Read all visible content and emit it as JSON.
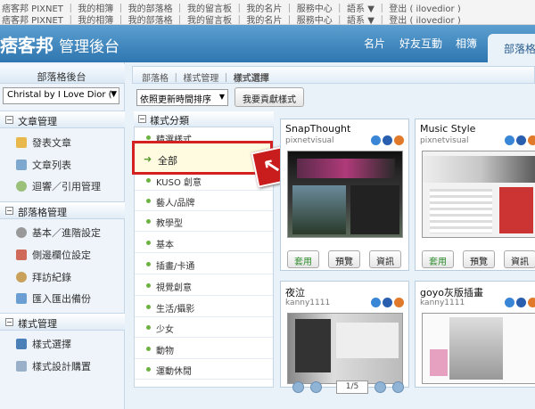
{
  "topbar": {
    "row1": "痞客邦 PIXNET ｜ 我的相簿 ｜ 我的部落格 ｜ 我的留言板 ｜ 我的名片 ｜ 服務中心 ｜ 語系 ▼ ｜ 登出 ( ilovedior )",
    "row2": "痞客邦 PIXNET ｜ 我的相簿 ｜ 我的部落格 ｜ 我的留言板 ｜ 我的名片 ｜ 服務中心 ｜ 語系 ▼ ｜ 登出 ( ilovedior )"
  },
  "header": {
    "logo": "痞客邦",
    "title": "管理後台",
    "nav": [
      "名片",
      "好友互動",
      "相簿"
    ],
    "active_tab": "部落格"
  },
  "sidebar": {
    "head": "部落格後台",
    "blog_select": "Christal by I Love Dior (",
    "sections": [
      {
        "title": "文章管理",
        "items": [
          "發表文章",
          "文章列表",
          "迴響／引用管理"
        ]
      },
      {
        "title": "部落格管理",
        "items": [
          "基本／進階設定",
          "側邊欄位設定",
          "拜訪紀錄",
          "匯入匯出備份"
        ]
      },
      {
        "title": "樣式管理",
        "items": [
          "樣式選擇",
          "樣式設計購置"
        ]
      }
    ]
  },
  "breadcrumb": [
    "部落格",
    "樣式管理",
    "樣式選擇"
  ],
  "sort": {
    "selected": "依照更新時間排序"
  },
  "contrib_button": "我要貢獻樣式",
  "categories": {
    "head": "樣式分類",
    "items": [
      "精選樣式",
      "全部",
      "KUSO 創意",
      "藝人/品牌",
      "教學型",
      "基本",
      "插畫/卡通",
      "視覺創意",
      "生活/攝影",
      "少女",
      "動物",
      "運動休閒"
    ],
    "active": "全部"
  },
  "themes": [
    {
      "title": "SnapThought",
      "author": "pixnetvisual"
    },
    {
      "title": "Music Style",
      "author": "pixnetvisual"
    },
    {
      "title": "夜泣",
      "author": "kanny1111"
    },
    {
      "title": "goyo灰版插畫",
      "author": "kanny1111"
    }
  ],
  "theme_buttons": {
    "apply": "套用",
    "preview": "預覽",
    "info": "資訊"
  },
  "pager": {
    "page": "1/5"
  },
  "colors": {
    "header": "#2f76b0",
    "highlight": "#d42020",
    "apply_text": "#2b8a2b"
  }
}
